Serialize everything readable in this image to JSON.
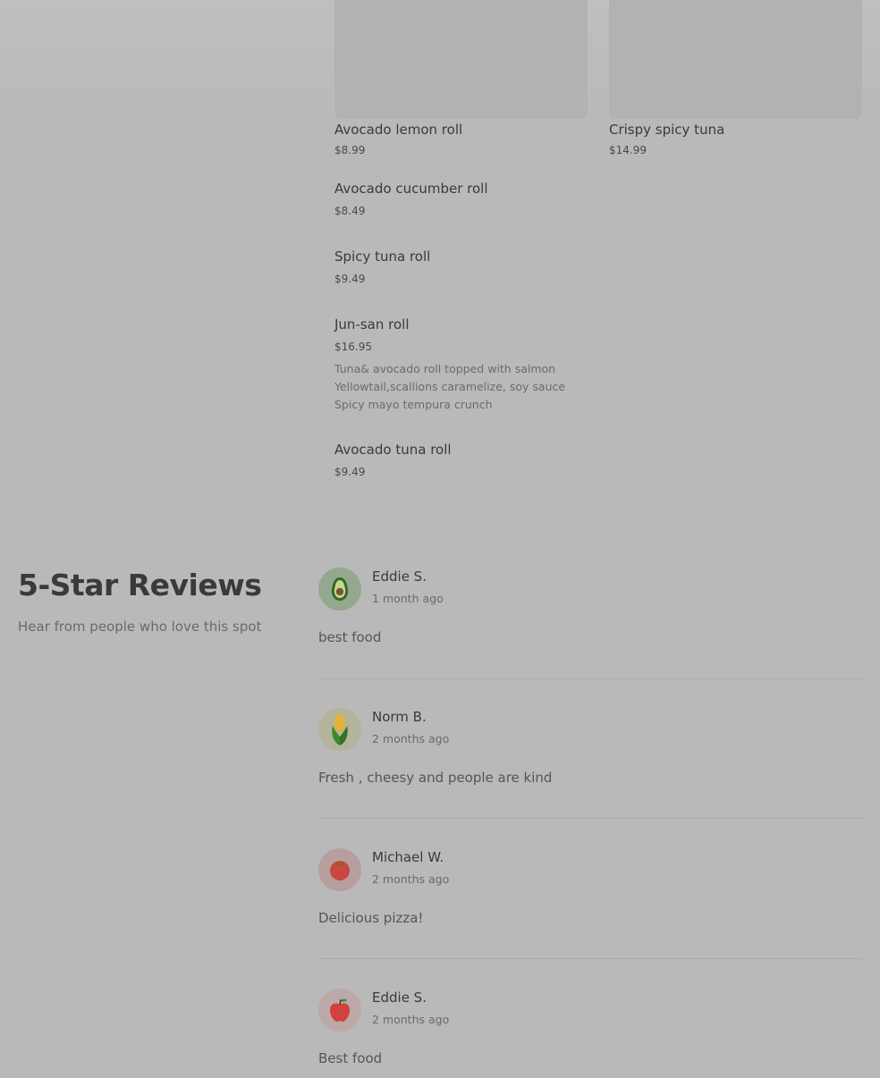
{
  "menu": {
    "items": [
      {
        "name": "Avocado lemon roll",
        "price": "$8.99"
      },
      {
        "name": "Crispy spicy tuna",
        "price": "$14.99"
      },
      {
        "name": "Avocado cucumber roll",
        "price": "$8.49"
      },
      {
        "name": "Spicy tuna roll",
        "price": "$9.49"
      },
      {
        "name": "Jun-san roll",
        "price": "$16.95",
        "desc_lines": [
          "Tuna& avocado roll topped with salmon",
          "Yellowtail,scallions caramelize, soy sauce",
          "Spicy mayo tempura crunch"
        ]
      },
      {
        "name": "Avocado tuna roll",
        "price": "$9.49"
      }
    ]
  },
  "reviews_section": {
    "title": "5-Star Reviews",
    "subtitle": "Hear from people who love this spot"
  },
  "reviews": [
    {
      "name": "Eddie S.",
      "time": "1 month ago",
      "text": "best food",
      "avatar_icon": "avocado-icon"
    },
    {
      "name": "Norm B.",
      "time": "2 months ago",
      "text": "Fresh , cheesy and people are kind",
      "avatar_icon": "corn-icon"
    },
    {
      "name": "Michael W.",
      "time": "2 months ago",
      "text": "Delicious pizza!",
      "avatar_icon": "tomato-icon"
    },
    {
      "name": "Eddie S.",
      "time": "2 months ago",
      "text": "Best food",
      "avatar_icon": "apple-icon"
    }
  ]
}
